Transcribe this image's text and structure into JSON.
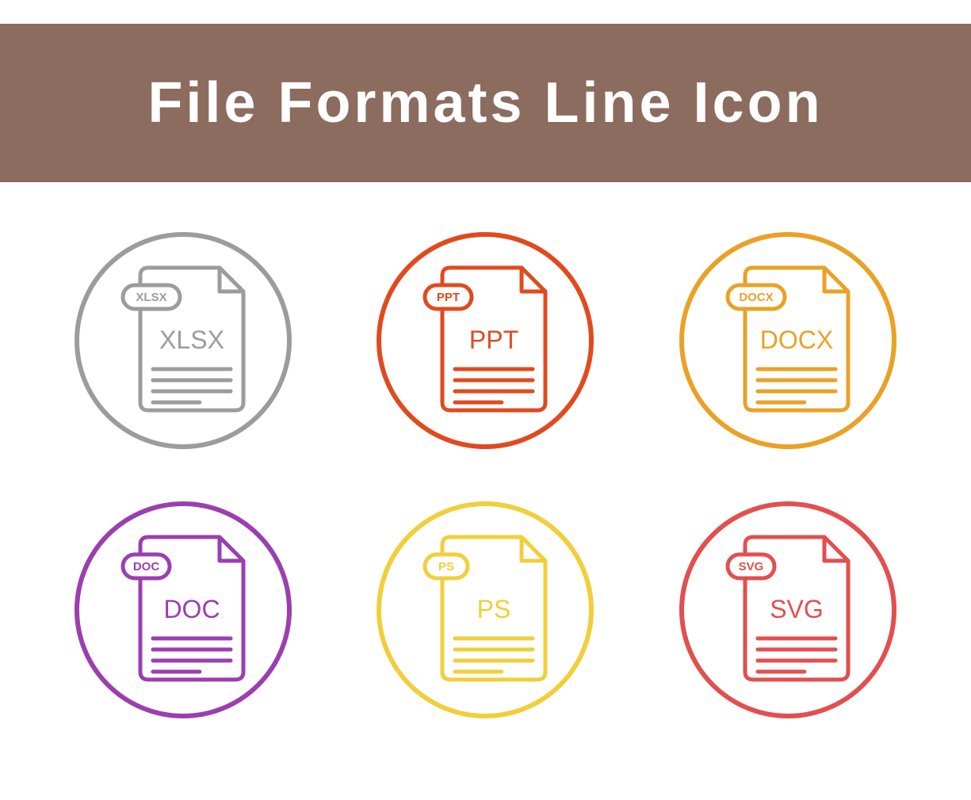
{
  "header": {
    "title": "File Formats Line Icon",
    "bg": "#8c6c5f"
  },
  "icons": [
    {
      "tag": "XLSX",
      "label": "XLSX",
      "color": "#9c9c9c"
    },
    {
      "tag": "PPT",
      "label": "PPT",
      "color": "#e14a1e"
    },
    {
      "tag": "DOCX",
      "label": "DOCX",
      "color": "#e9a227"
    },
    {
      "tag": "DOC",
      "label": "DOC",
      "color": "#9b3fb0"
    },
    {
      "tag": "PS",
      "label": "PS",
      "color": "#f0cf3a"
    },
    {
      "tag": "SVG",
      "label": "SVG",
      "color": "#e34f4f"
    }
  ]
}
